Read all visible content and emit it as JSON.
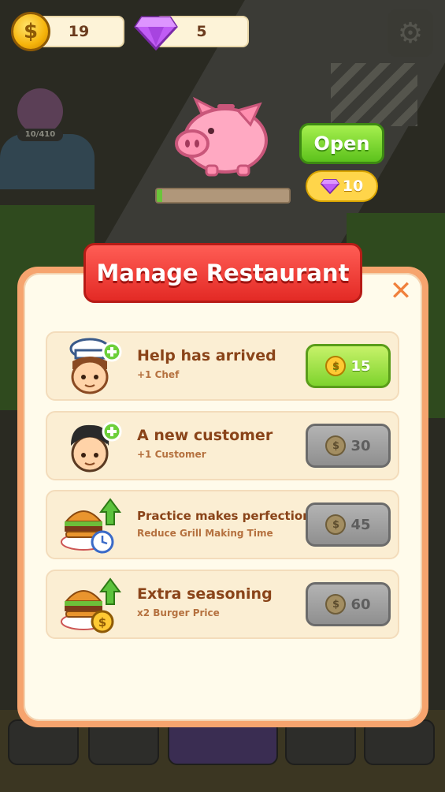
{
  "hud": {
    "coins": "19",
    "gems": "5",
    "coin_symbol": "$"
  },
  "background": {
    "level_text": "10/410"
  },
  "piggy_bank": {
    "open_label": "Open",
    "open_cost": "10",
    "progress": 0.04
  },
  "panel": {
    "title": "Manage Restaurant",
    "close_label": "✕"
  },
  "upgrades": [
    {
      "title": "Help has arrived",
      "subtitle": "+1 Chef",
      "price": "15",
      "state": "active",
      "icon": "chef-icon"
    },
    {
      "title": "A new customer",
      "subtitle": "+1 Customer",
      "price": "30",
      "state": "locked",
      "icon": "customer-icon"
    },
    {
      "title": "Practice makes perfection",
      "subtitle": "Reduce Grill Making Time",
      "price": "45",
      "state": "locked",
      "icon": "burger-timer-icon"
    },
    {
      "title": "Extra seasoning",
      "subtitle": "x2 Burger Price",
      "price": "60",
      "state": "locked",
      "icon": "burger-coin-icon"
    }
  ],
  "colors": {
    "banner_red": "#e32a25",
    "panel_border": "#f6a46e",
    "active_green": "#7ed32d",
    "locked_grey": "#8f8f8f",
    "title_brown": "#8a4419"
  }
}
